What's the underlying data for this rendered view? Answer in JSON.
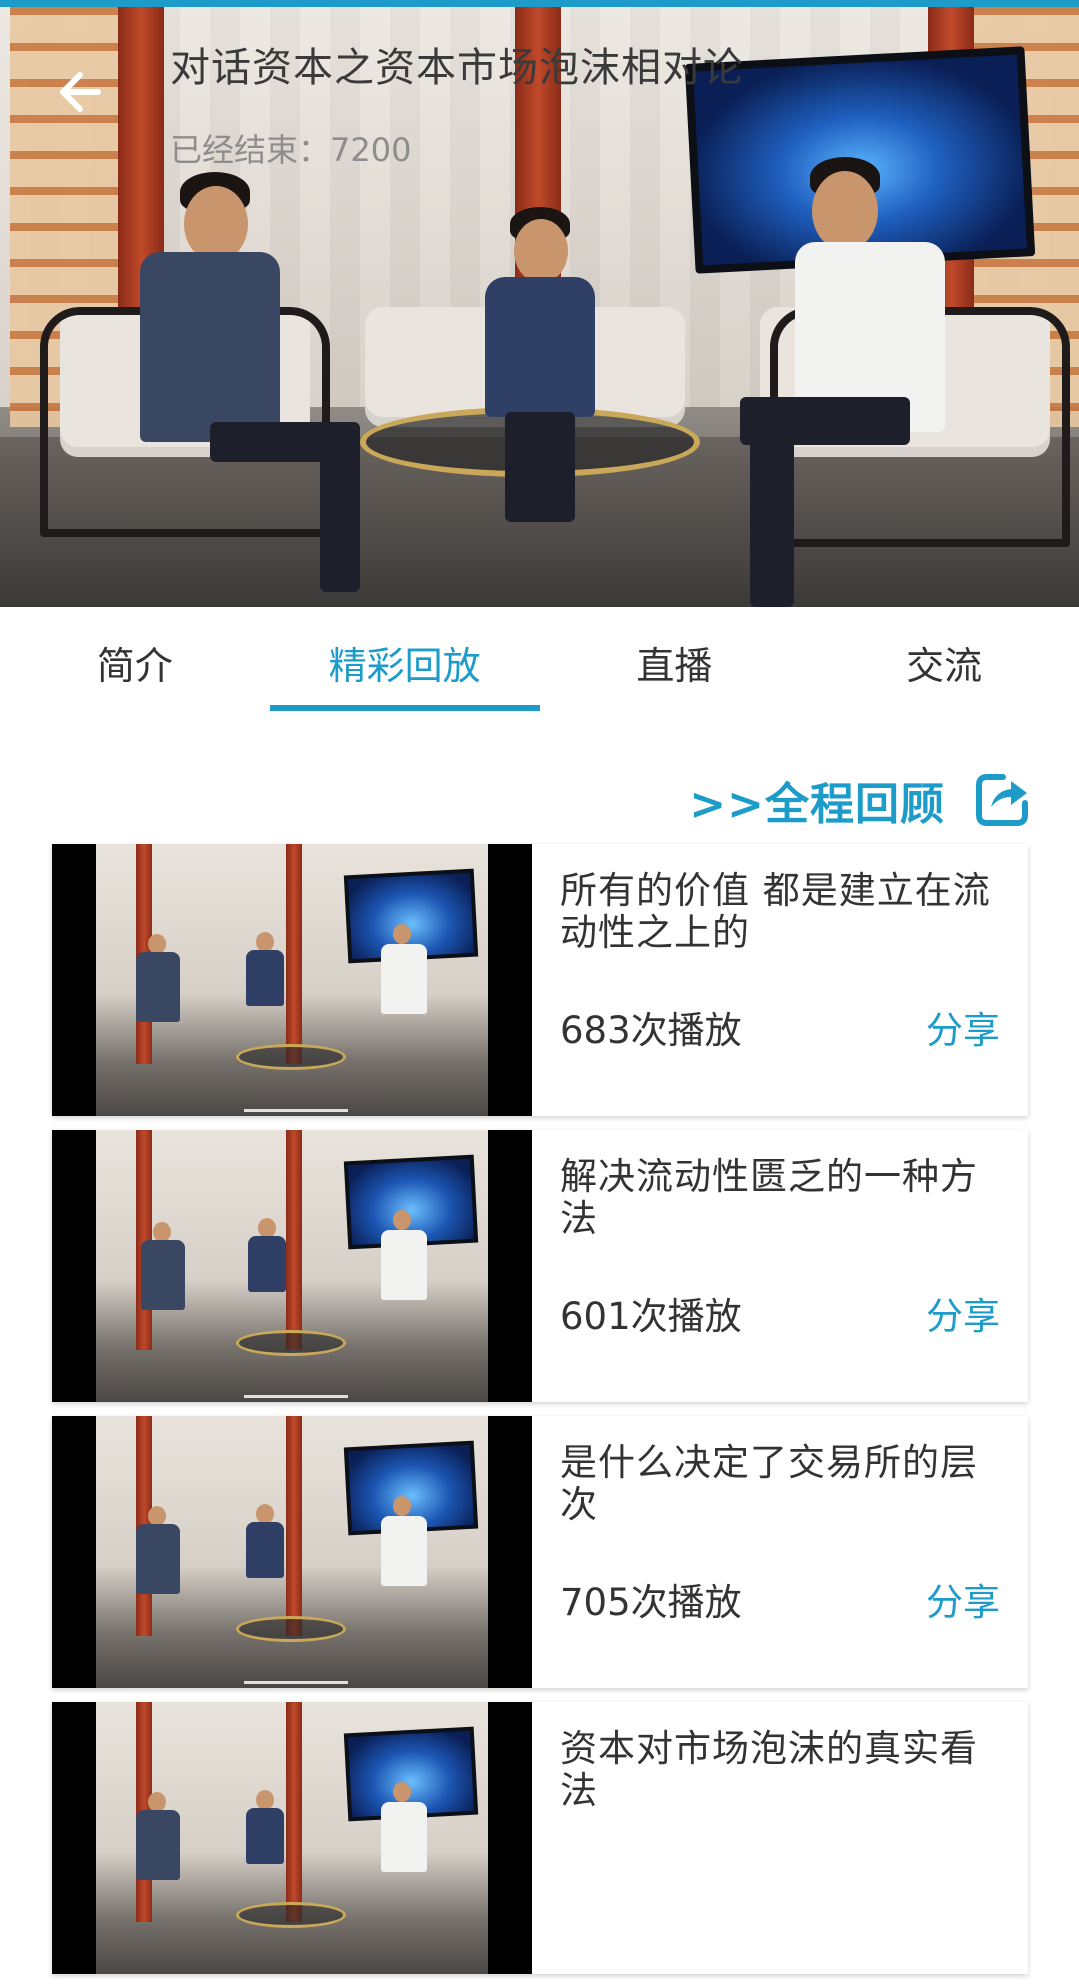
{
  "theme": {
    "accent": "#1d9bc9",
    "text": "#333333",
    "muted": "#8d8d8d"
  },
  "header": {
    "back_icon": "arrow-left-icon",
    "title": "对话资本之资本市场泡沫相对论",
    "status": "已经结束：7200"
  },
  "tabs": [
    {
      "label": "简介",
      "active": false
    },
    {
      "label": "精彩回放",
      "active": true
    },
    {
      "label": "直播",
      "active": false
    },
    {
      "label": "交流",
      "active": false
    }
  ],
  "full_review": {
    "label": ">>全程回顾",
    "icon": "share-export-icon"
  },
  "playlist": [
    {
      "title": "所有的价值 都是建立在流动性之上的",
      "plays": "683次播放",
      "share": "分享"
    },
    {
      "title": "解决流动性匮乏的一种方法",
      "plays": "601次播放",
      "share": "分享"
    },
    {
      "title": "是什么决定了交易所的层次",
      "plays": "705次播放",
      "share": "分享"
    },
    {
      "title": "资本对市场泡沫的真实看法",
      "plays": "",
      "share": ""
    }
  ]
}
